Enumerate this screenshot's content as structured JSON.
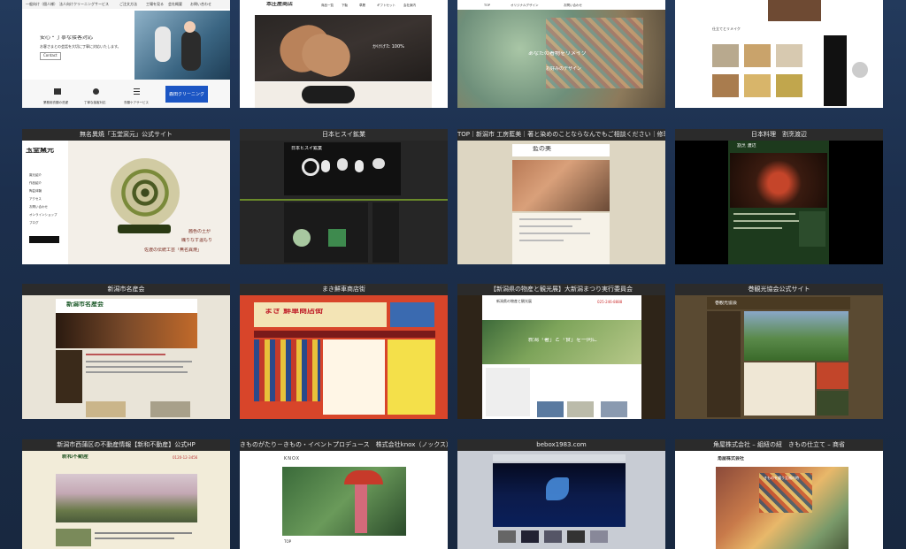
{
  "tiles": [
    {
      "title": "",
      "lines": [
        "安心・丁寧な接客対応",
        "お客さまとの会話を大切に丁寧に対応いたします。",
        "Contact",
        "業務用衣類の洗濯",
        "丁寧な接客対応",
        "衣類ケアサービス",
        "森田クリーニング"
      ],
      "nav": [
        "一般向け（個人様）",
        "法人向けクリーニングサービス",
        "ご注文方法",
        "工場を見る",
        "会社概要",
        "お問い合わせ"
      ]
    },
    {
      "title": "",
      "lines": [
        "本庄屋商店",
        "かけげた 100%"
      ],
      "nav": [
        "商品一覧",
        "下駄",
        "草履",
        "ギフトセット",
        "会社案内"
      ]
    },
    {
      "title": "",
      "lines": [
        "あなたの着物をリメイク",
        "お好みのデザイン"
      ],
      "nav": [
        "TOP",
        "オリジナルデザイン",
        "お問い合わせ"
      ]
    },
    {
      "title": "",
      "lines": [
        "仕立てとリメイク"
      ],
      "nav": []
    },
    {
      "title": "無名異焼「玉堂窯元」公式サイト",
      "lines": [
        "玉堂窯元",
        "茜色の土が",
        "織りなす温もり",
        "佐渡の伝統工芸「無名異焼」"
      ],
      "nav": [
        "窯元紹介",
        "作品紹介",
        "陶芸体験",
        "アクセス",
        "お問い合わせ",
        "オンラインショップ",
        "ブログ"
      ]
    },
    {
      "title": "日本ヒスイ鉱業",
      "lines": [
        "日本ヒスイ鉱業"
      ],
      "nav": []
    },
    {
      "title": "TOP｜新潟市 工房藍美｜著と染めのことならなんでもご相談ください｜修理か…",
      "lines": [
        "藍の美"
      ],
      "nav": []
    },
    {
      "title": "日本料理　割烹渡辺",
      "lines": [
        "割烹 渡辺"
      ],
      "nav": []
    },
    {
      "title": "新潟市名産会",
      "lines": [
        "新潟市名産会"
      ],
      "nav": []
    },
    {
      "title": "まき鮮車商店街",
      "lines": [
        "まき 鮮車商店街"
      ],
      "nav": []
    },
    {
      "title": "【新潟県の物産と観光展】大新潟まつり実行委員会",
      "lines": [
        "新潟県の物産と観光展",
        "新潟「暑」と「食」を一同に",
        "025-246-8888"
      ],
      "nav": []
    },
    {
      "title": "巻観光協会公式サイト",
      "lines": [
        "巻観光協会"
      ],
      "nav": []
    },
    {
      "title": "新潟市西蒲区の不動産情報【新和不動産】公式HP",
      "lines": [
        "新和不動産",
        "0120-12-3456"
      ],
      "nav": []
    },
    {
      "title": "きものがたり－きもの・イベントプロデュース　株式会社knox（ノックス）",
      "lines": [
        "KNOX",
        "TOP"
      ],
      "nav": []
    },
    {
      "title": "bebox1983.com",
      "lines": [
        "bebox1983"
      ],
      "nav": []
    },
    {
      "title": "角屋株式会社 – 組紐の紐　きもの仕立て – 商省",
      "lines": [
        "角屋株式会社",
        "きものを纏う至福の時"
      ],
      "nav": []
    }
  ],
  "colors": {
    "background": "#1c2f4d",
    "title_bar": "#2b2b2b",
    "tile_title_text": "#e8e8e8"
  }
}
